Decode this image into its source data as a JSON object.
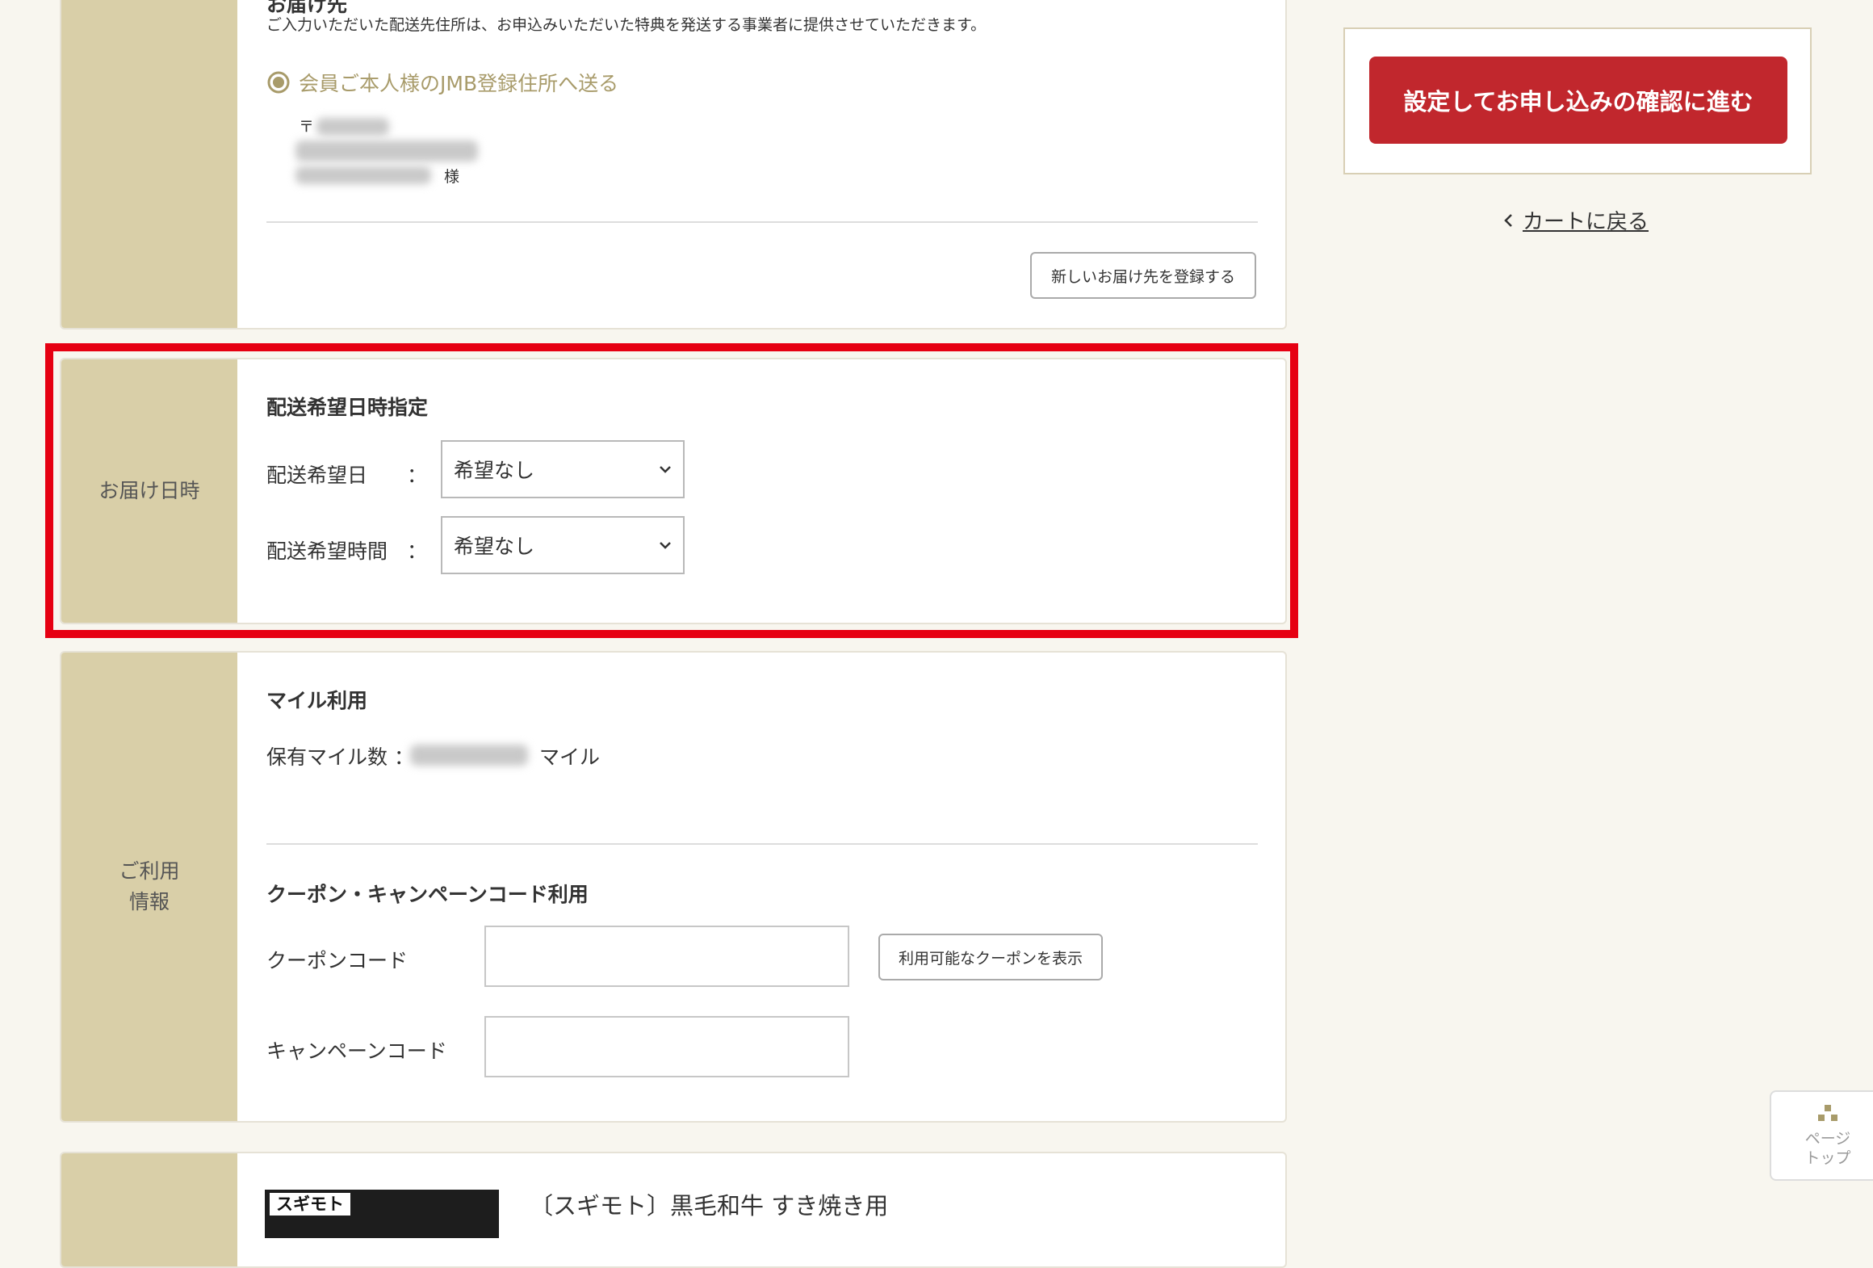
{
  "address_card": {
    "heading_partial": "お届け先",
    "notice": "ご入力いただいた配送先住所は、お申込みいただいた特典を発送する事業者に提供させていただきます。",
    "radio_label": "会員ご本人様のJMB登録住所へ送る",
    "postal_mark": "〒",
    "honorific": "様",
    "new_address_button": "新しいお届け先を登録する"
  },
  "delivery_card": {
    "side_label": "お届け日時",
    "title": "配送希望日時指定",
    "date_label": "配送希望日",
    "time_label": "配送希望時間",
    "colon": "：",
    "date_value": "希望なし",
    "time_value": "希望なし"
  },
  "usage_card": {
    "side_label": "ご利用\n情報",
    "miles_title": "マイル利用",
    "miles_label": "保有マイル数 ：",
    "miles_unit": "マイル",
    "coupon_title": "クーポン・キャンペーンコード利用",
    "coupon_label": "クーポンコード",
    "campaign_label": "キャンペーンコード",
    "show_coupons_button": "利用可能なクーポンを表示"
  },
  "product_card": {
    "product_name": "〔スギモト〕黒毛和牛 すき焼き用",
    "logo_text": "スギモト"
  },
  "sidebar": {
    "confirm_button": "設定してお申し込みの確認に進む",
    "back_link": "カートに戻る"
  },
  "page_top": {
    "line1": "ページ",
    "line2": "トップ"
  },
  "colors": {
    "accent_red": "#c1272d",
    "highlight_red": "#e60012",
    "side_tan": "#d9cfa8"
  }
}
